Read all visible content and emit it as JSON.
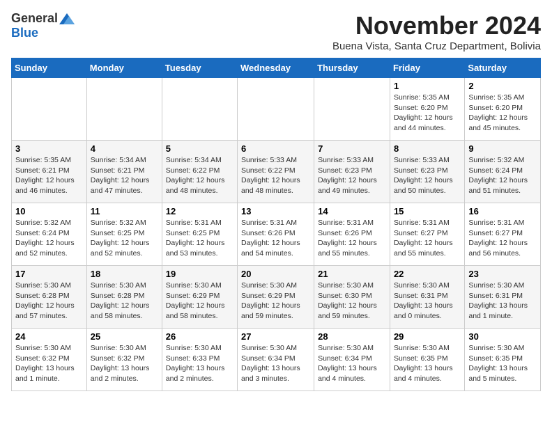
{
  "header": {
    "logo_general": "General",
    "logo_blue": "Blue",
    "month_title": "November 2024",
    "location": "Buena Vista, Santa Cruz Department, Bolivia"
  },
  "days_of_week": [
    "Sunday",
    "Monday",
    "Tuesday",
    "Wednesday",
    "Thursday",
    "Friday",
    "Saturday"
  ],
  "weeks": [
    [
      {
        "day": "",
        "info": ""
      },
      {
        "day": "",
        "info": ""
      },
      {
        "day": "",
        "info": ""
      },
      {
        "day": "",
        "info": ""
      },
      {
        "day": "",
        "info": ""
      },
      {
        "day": "1",
        "info": "Sunrise: 5:35 AM\nSunset: 6:20 PM\nDaylight: 12 hours\nand 44 minutes."
      },
      {
        "day": "2",
        "info": "Sunrise: 5:35 AM\nSunset: 6:20 PM\nDaylight: 12 hours\nand 45 minutes."
      }
    ],
    [
      {
        "day": "3",
        "info": "Sunrise: 5:35 AM\nSunset: 6:21 PM\nDaylight: 12 hours\nand 46 minutes."
      },
      {
        "day": "4",
        "info": "Sunrise: 5:34 AM\nSunset: 6:21 PM\nDaylight: 12 hours\nand 47 minutes."
      },
      {
        "day": "5",
        "info": "Sunrise: 5:34 AM\nSunset: 6:22 PM\nDaylight: 12 hours\nand 48 minutes."
      },
      {
        "day": "6",
        "info": "Sunrise: 5:33 AM\nSunset: 6:22 PM\nDaylight: 12 hours\nand 48 minutes."
      },
      {
        "day": "7",
        "info": "Sunrise: 5:33 AM\nSunset: 6:23 PM\nDaylight: 12 hours\nand 49 minutes."
      },
      {
        "day": "8",
        "info": "Sunrise: 5:33 AM\nSunset: 6:23 PM\nDaylight: 12 hours\nand 50 minutes."
      },
      {
        "day": "9",
        "info": "Sunrise: 5:32 AM\nSunset: 6:24 PM\nDaylight: 12 hours\nand 51 minutes."
      }
    ],
    [
      {
        "day": "10",
        "info": "Sunrise: 5:32 AM\nSunset: 6:24 PM\nDaylight: 12 hours\nand 52 minutes."
      },
      {
        "day": "11",
        "info": "Sunrise: 5:32 AM\nSunset: 6:25 PM\nDaylight: 12 hours\nand 52 minutes."
      },
      {
        "day": "12",
        "info": "Sunrise: 5:31 AM\nSunset: 6:25 PM\nDaylight: 12 hours\nand 53 minutes."
      },
      {
        "day": "13",
        "info": "Sunrise: 5:31 AM\nSunset: 6:26 PM\nDaylight: 12 hours\nand 54 minutes."
      },
      {
        "day": "14",
        "info": "Sunrise: 5:31 AM\nSunset: 6:26 PM\nDaylight: 12 hours\nand 55 minutes."
      },
      {
        "day": "15",
        "info": "Sunrise: 5:31 AM\nSunset: 6:27 PM\nDaylight: 12 hours\nand 55 minutes."
      },
      {
        "day": "16",
        "info": "Sunrise: 5:31 AM\nSunset: 6:27 PM\nDaylight: 12 hours\nand 56 minutes."
      }
    ],
    [
      {
        "day": "17",
        "info": "Sunrise: 5:30 AM\nSunset: 6:28 PM\nDaylight: 12 hours\nand 57 minutes."
      },
      {
        "day": "18",
        "info": "Sunrise: 5:30 AM\nSunset: 6:28 PM\nDaylight: 12 hours\nand 58 minutes."
      },
      {
        "day": "19",
        "info": "Sunrise: 5:30 AM\nSunset: 6:29 PM\nDaylight: 12 hours\nand 58 minutes."
      },
      {
        "day": "20",
        "info": "Sunrise: 5:30 AM\nSunset: 6:29 PM\nDaylight: 12 hours\nand 59 minutes."
      },
      {
        "day": "21",
        "info": "Sunrise: 5:30 AM\nSunset: 6:30 PM\nDaylight: 12 hours\nand 59 minutes."
      },
      {
        "day": "22",
        "info": "Sunrise: 5:30 AM\nSunset: 6:31 PM\nDaylight: 13 hours\nand 0 minutes."
      },
      {
        "day": "23",
        "info": "Sunrise: 5:30 AM\nSunset: 6:31 PM\nDaylight: 13 hours\nand 1 minute."
      }
    ],
    [
      {
        "day": "24",
        "info": "Sunrise: 5:30 AM\nSunset: 6:32 PM\nDaylight: 13 hours\nand 1 minute."
      },
      {
        "day": "25",
        "info": "Sunrise: 5:30 AM\nSunset: 6:32 PM\nDaylight: 13 hours\nand 2 minutes."
      },
      {
        "day": "26",
        "info": "Sunrise: 5:30 AM\nSunset: 6:33 PM\nDaylight: 13 hours\nand 2 minutes."
      },
      {
        "day": "27",
        "info": "Sunrise: 5:30 AM\nSunset: 6:34 PM\nDaylight: 13 hours\nand 3 minutes."
      },
      {
        "day": "28",
        "info": "Sunrise: 5:30 AM\nSunset: 6:34 PM\nDaylight: 13 hours\nand 4 minutes."
      },
      {
        "day": "29",
        "info": "Sunrise: 5:30 AM\nSunset: 6:35 PM\nDaylight: 13 hours\nand 4 minutes."
      },
      {
        "day": "30",
        "info": "Sunrise: 5:30 AM\nSunset: 6:35 PM\nDaylight: 13 hours\nand 5 minutes."
      }
    ]
  ]
}
